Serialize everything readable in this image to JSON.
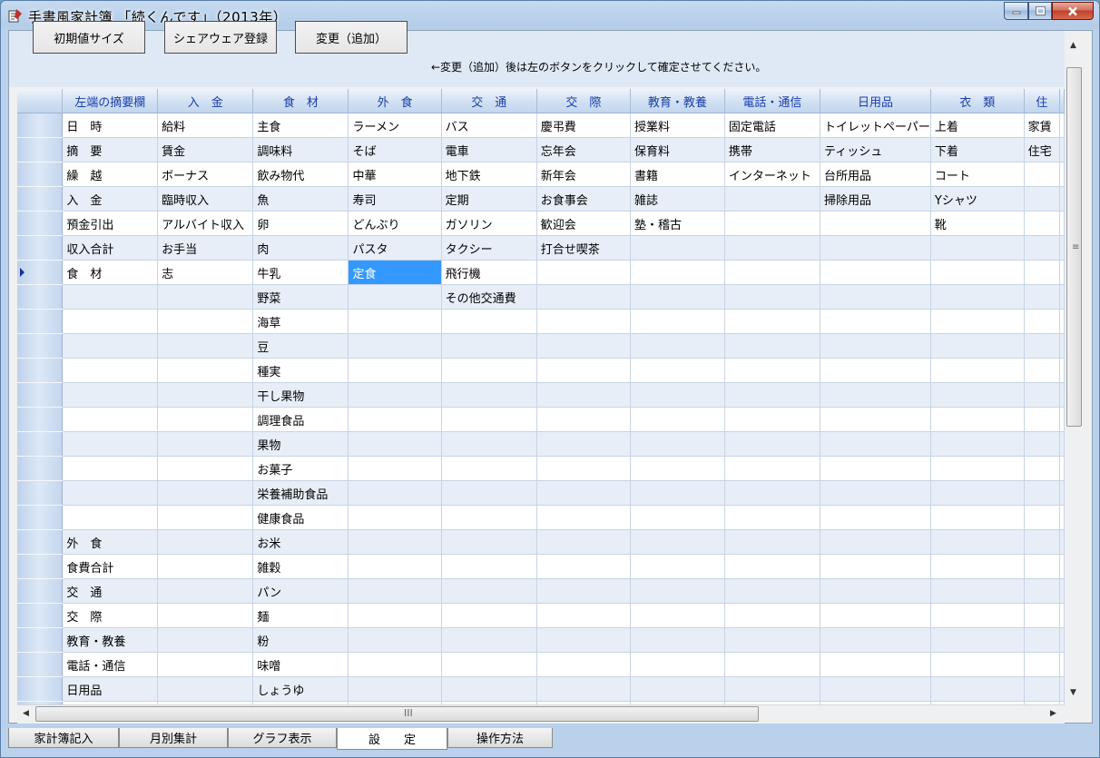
{
  "window": {
    "title": "手書風家計簿 「続くんです」（2013年）"
  },
  "toolbar": {
    "btn_default_size": "初期値サイズ",
    "btn_shareware": "シェアウェア登録",
    "btn_change_add": "変更（追加）",
    "hint": "←変更（追加）後は左のボタンをクリックして確定させてください。"
  },
  "grid": {
    "headers": [
      "左端の摘要欄",
      "入　金",
      "食　材",
      "外　食",
      "交　通",
      "交　際",
      "教育・教養",
      "電話・通信",
      "日用品",
      "衣　類",
      "住"
    ],
    "rows": [
      [
        "日　時",
        "給料",
        "主食",
        "ラーメン",
        "バス",
        "慶弔費",
        "授業料",
        "固定電話",
        "トイレットペーパー",
        "上着",
        "家賃"
      ],
      [
        "摘　要",
        "賃金",
        "調味料",
        "そば",
        "電車",
        "忘年会",
        "保育料",
        "携帯",
        "ティッシュ",
        "下着",
        "住宅"
      ],
      [
        "繰　越",
        "ボーナス",
        "飲み物代",
        "中華",
        "地下鉄",
        "新年会",
        "書籍",
        "インターネット",
        "台所用品",
        "コート",
        ""
      ],
      [
        "入　金",
        "臨時収入",
        "魚",
        "寿司",
        "定期",
        "お食事会",
        "雑誌",
        "",
        "掃除用品",
        "Yシャツ",
        ""
      ],
      [
        "預金引出",
        "アルバイト収入",
        "卵",
        "どんぶり",
        "ガソリン",
        "歓迎会",
        "塾・稽古",
        "",
        "",
        "靴",
        ""
      ],
      [
        "収入合計",
        "お手当",
        "肉",
        "パスタ",
        "タクシー",
        "打合せ喫茶",
        "",
        "",
        "",
        "",
        ""
      ],
      [
        "食　材",
        "志",
        "牛乳",
        "定食",
        "飛行機",
        "",
        "",
        "",
        "",
        "",
        ""
      ],
      [
        "",
        "",
        "野菜",
        "",
        "その他交通費",
        "",
        "",
        "",
        "",
        "",
        ""
      ],
      [
        "",
        "",
        "海草",
        "",
        "",
        "",
        "",
        "",
        "",
        "",
        ""
      ],
      [
        "",
        "",
        "豆",
        "",
        "",
        "",
        "",
        "",
        "",
        "",
        ""
      ],
      [
        "",
        "",
        "種実",
        "",
        "",
        "",
        "",
        "",
        "",
        "",
        ""
      ],
      [
        "",
        "",
        "干し果物",
        "",
        "",
        "",
        "",
        "",
        "",
        "",
        ""
      ],
      [
        "",
        "",
        "調理食品",
        "",
        "",
        "",
        "",
        "",
        "",
        "",
        ""
      ],
      [
        "",
        "",
        "果物",
        "",
        "",
        "",
        "",
        "",
        "",
        "",
        ""
      ],
      [
        "",
        "",
        "お菓子",
        "",
        "",
        "",
        "",
        "",
        "",
        "",
        ""
      ],
      [
        "",
        "",
        "栄養補助食品",
        "",
        "",
        "",
        "",
        "",
        "",
        "",
        ""
      ],
      [
        "",
        "",
        "健康食品",
        "",
        "",
        "",
        "",
        "",
        "",
        "",
        ""
      ],
      [
        "外　食",
        "",
        "お米",
        "",
        "",
        "",
        "",
        "",
        "",
        "",
        ""
      ],
      [
        "食費合計",
        "",
        "雑穀",
        "",
        "",
        "",
        "",
        "",
        "",
        "",
        ""
      ],
      [
        "交　通",
        "",
        "パン",
        "",
        "",
        "",
        "",
        "",
        "",
        "",
        ""
      ],
      [
        "交　際",
        "",
        "麺",
        "",
        "",
        "",
        "",
        "",
        "",
        "",
        ""
      ],
      [
        "教育・教養",
        "",
        "粉",
        "",
        "",
        "",
        "",
        "",
        "",
        "",
        ""
      ],
      [
        "電話・通信",
        "",
        "味噌",
        "",
        "",
        "",
        "",
        "",
        "",
        "",
        ""
      ],
      [
        "日用品",
        "",
        "しょうゆ",
        "",
        "",
        "",
        "",
        "",
        "",
        "",
        ""
      ],
      [
        "",
        "",
        "",
        "",
        "",
        "",
        "",
        "",
        "",
        "",
        ""
      ]
    ],
    "selected": {
      "row": 6,
      "col": 3
    },
    "current_row": 6
  },
  "scrollbars": {
    "v_grip": "≡",
    "h_grip": "III"
  },
  "tabs": [
    {
      "label": "家計簿記入",
      "active": false
    },
    {
      "label": "月別集計",
      "active": false
    },
    {
      "label": "グラフ表示",
      "active": false
    },
    {
      "label": "設　　定",
      "active": true
    },
    {
      "label": "操作方法",
      "active": false
    }
  ],
  "colors": {
    "header_text": "#1a3ea8",
    "selection": "#3399ff",
    "row_alt": "#e7eef8"
  }
}
